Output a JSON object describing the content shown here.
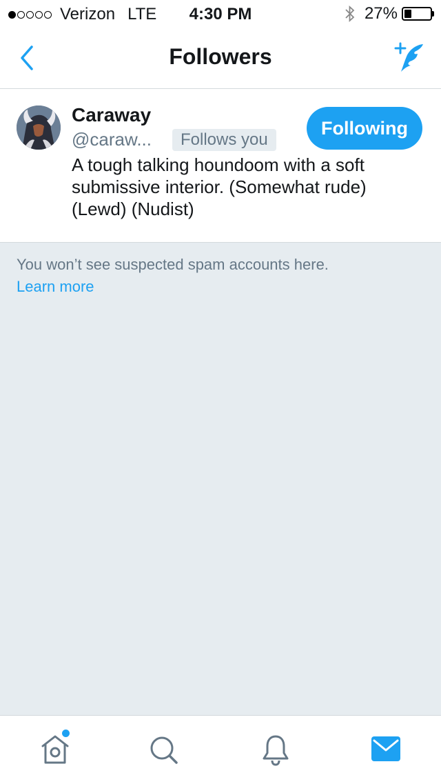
{
  "status_bar": {
    "carrier": "Verizon",
    "network": "LTE",
    "time": "4:30 PM",
    "battery": "27%",
    "battery_level": 0.27
  },
  "nav": {
    "title": "Followers",
    "back_icon": "chevron-left-icon",
    "compose_icon": "add-feather-icon"
  },
  "follower": {
    "display_name": "Caraway",
    "handle": "@caraw...",
    "badge": "Follows you",
    "bio": "A tough talking houndoom with a soft submissive interior. (Somewhat rude) (Lewd) (Nudist)",
    "button_label": "Following"
  },
  "notice": {
    "text": "You won’t see suspected spam accounts here.",
    "link": "Learn more"
  },
  "tabs": [
    {
      "name": "home",
      "icon": "home-icon"
    },
    {
      "name": "search",
      "icon": "search-icon"
    },
    {
      "name": "notifications",
      "icon": "bell-icon"
    },
    {
      "name": "messages",
      "icon": "envelope-icon"
    }
  ],
  "colors": {
    "accent": "#1da1f2",
    "background": "#e6ecf0",
    "secondary_text": "#657786"
  }
}
